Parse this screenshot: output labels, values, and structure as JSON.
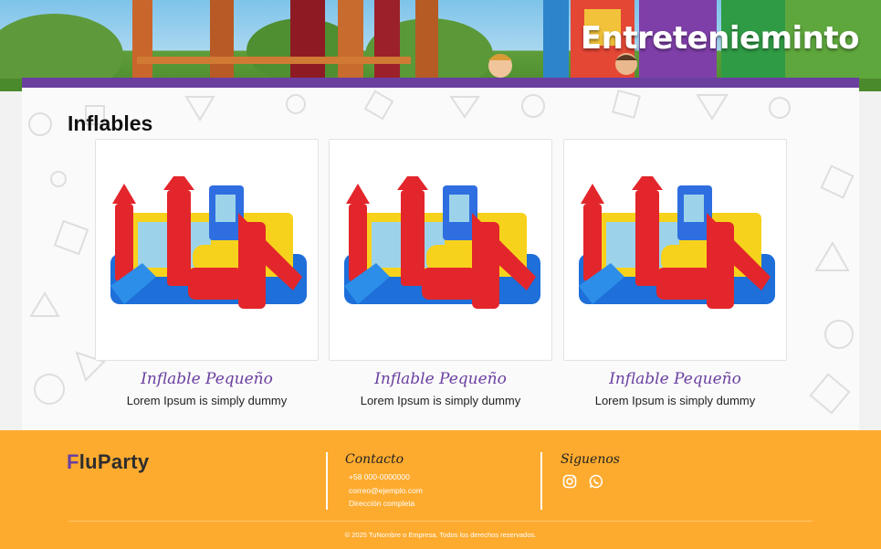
{
  "hero": {
    "title": "Entretenieminto"
  },
  "section": {
    "title": "Inflables"
  },
  "products": [
    {
      "name": "Inflable Pequeño",
      "description": "Lorem Ipsum is simply dummy"
    },
    {
      "name": "Inflable Pequeño",
      "description": "Lorem Ipsum is simply dummy"
    },
    {
      "name": "Inflable Pequeño",
      "description": "Lorem Ipsum is simply dummy"
    }
  ],
  "footer": {
    "logo_initial": "F",
    "logo_rest": "luParty",
    "contact_title": "Contacto",
    "phone": "+58 000-0000000",
    "email": "correo@ejemplo.com",
    "address": "Dirección completa",
    "social_title": "Siguenos",
    "social_icons": [
      "instagram-icon",
      "whatsapp-icon"
    ],
    "copyright": "© 2025 TuNombre o Empresa. Todos los derechos reservados."
  },
  "colors": {
    "accent": "#6a3fa0",
    "footer": "#fdab2f",
    "product_name": "#6a3fa0"
  }
}
